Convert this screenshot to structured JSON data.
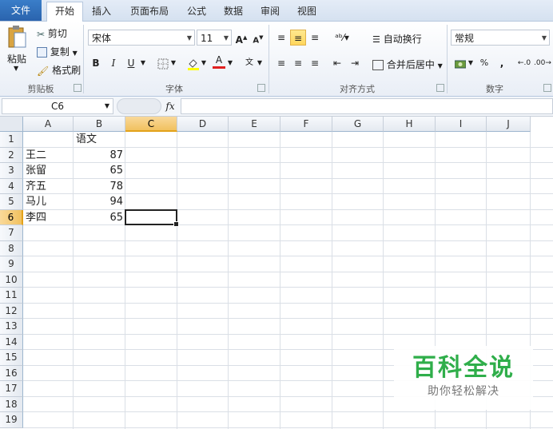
{
  "tabs": [
    "文件",
    "开始",
    "插入",
    "页面布局",
    "公式",
    "数据",
    "审阅",
    "视图"
  ],
  "ribbon": {
    "clipboard": {
      "paste": "粘贴",
      "cut": "剪切",
      "copy": "复制",
      "format_painter": "格式刷",
      "label": "剪贴板"
    },
    "font": {
      "name": "宋体",
      "size": "11",
      "bold": "B",
      "italic": "I",
      "underline": "U",
      "grow": "A",
      "shrink": "A",
      "font_color_glyph": "A",
      "phonetic_glyph": "文",
      "label": "字体"
    },
    "alignment": {
      "wrap_text": "自动换行",
      "merge_center": "合并后居中",
      "label": "对齐方式"
    },
    "number": {
      "format": "常规",
      "percent": "%",
      "comma": ",",
      "label": "数字"
    }
  },
  "formula_bar": {
    "name_box": "C6",
    "fx": "fx",
    "value": ""
  },
  "columns": [
    "A",
    "B",
    "C",
    "D",
    "E",
    "F",
    "G",
    "H",
    "I",
    "J"
  ],
  "rows": [
    "1",
    "2",
    "3",
    "4",
    "5",
    "6",
    "7",
    "8",
    "9",
    "10",
    "11",
    "12",
    "13",
    "14",
    "15",
    "16",
    "17",
    "18",
    "19"
  ],
  "selected": {
    "column": "C",
    "row": "6"
  },
  "sheet": {
    "header_b1": "语文",
    "data": [
      {
        "name": "王二",
        "score": "87"
      },
      {
        "name": "张留",
        "score": "65"
      },
      {
        "name": "齐五",
        "score": "78"
      },
      {
        "name": "马儿",
        "score": "94"
      },
      {
        "name": "李四",
        "score": "65"
      }
    ]
  },
  "watermark": {
    "title": "百科全说",
    "subtitle": "助你轻松解决"
  },
  "colors": {
    "file_tab": "#2a63ad",
    "selection_header": "#f1c15f",
    "watermark_green": "#2fae4a"
  }
}
